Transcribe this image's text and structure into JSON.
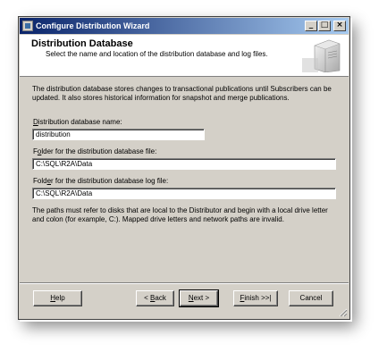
{
  "window": {
    "title": "Configure Distribution Wizard",
    "controls": {
      "minimize": "_",
      "maximize": "□",
      "close": "×"
    }
  },
  "header": {
    "title": "Distribution Database",
    "subtitle": "Select the name and location of the distribution database and log files.",
    "icon": "server-icon"
  },
  "content": {
    "intro": "The distribution database stores changes to transactional publications until Subscribers can be updated. It also stores historical information for snapshot and merge publications.",
    "db_name": {
      "label_pre": "",
      "label_accel": "D",
      "label_post": "istribution database name:",
      "value": "distribution"
    },
    "data_folder": {
      "label_pre": "F",
      "label_accel": "o",
      "label_post": "lder for the distribution database file:",
      "value": "C:\\SQL\\R2A\\Data"
    },
    "log_folder": {
      "label_pre": "Fold",
      "label_accel": "e",
      "label_post": "r for the distribution database log file:",
      "value": "C:\\SQL\\R2A\\Data"
    },
    "note": "The paths must refer to disks that are local to the Distributor and begin with a local drive letter and colon (for example, C:). Mapped drive letters and network paths are invalid."
  },
  "buttons": {
    "help": {
      "pre": "",
      "accel": "H",
      "post": "elp"
    },
    "back": {
      "pre": "< ",
      "accel": "B",
      "post": "ack"
    },
    "next": {
      "pre": "",
      "accel": "N",
      "post": "ext >"
    },
    "finish": {
      "pre": "",
      "accel": "F",
      "post": "inish >>|"
    },
    "cancel": {
      "pre": "Cancel",
      "accel": "",
      "post": ""
    }
  },
  "colors": {
    "dialog_bg": "#d4d0c8",
    "title_start": "#0a246a",
    "title_end": "#a6caf0"
  }
}
